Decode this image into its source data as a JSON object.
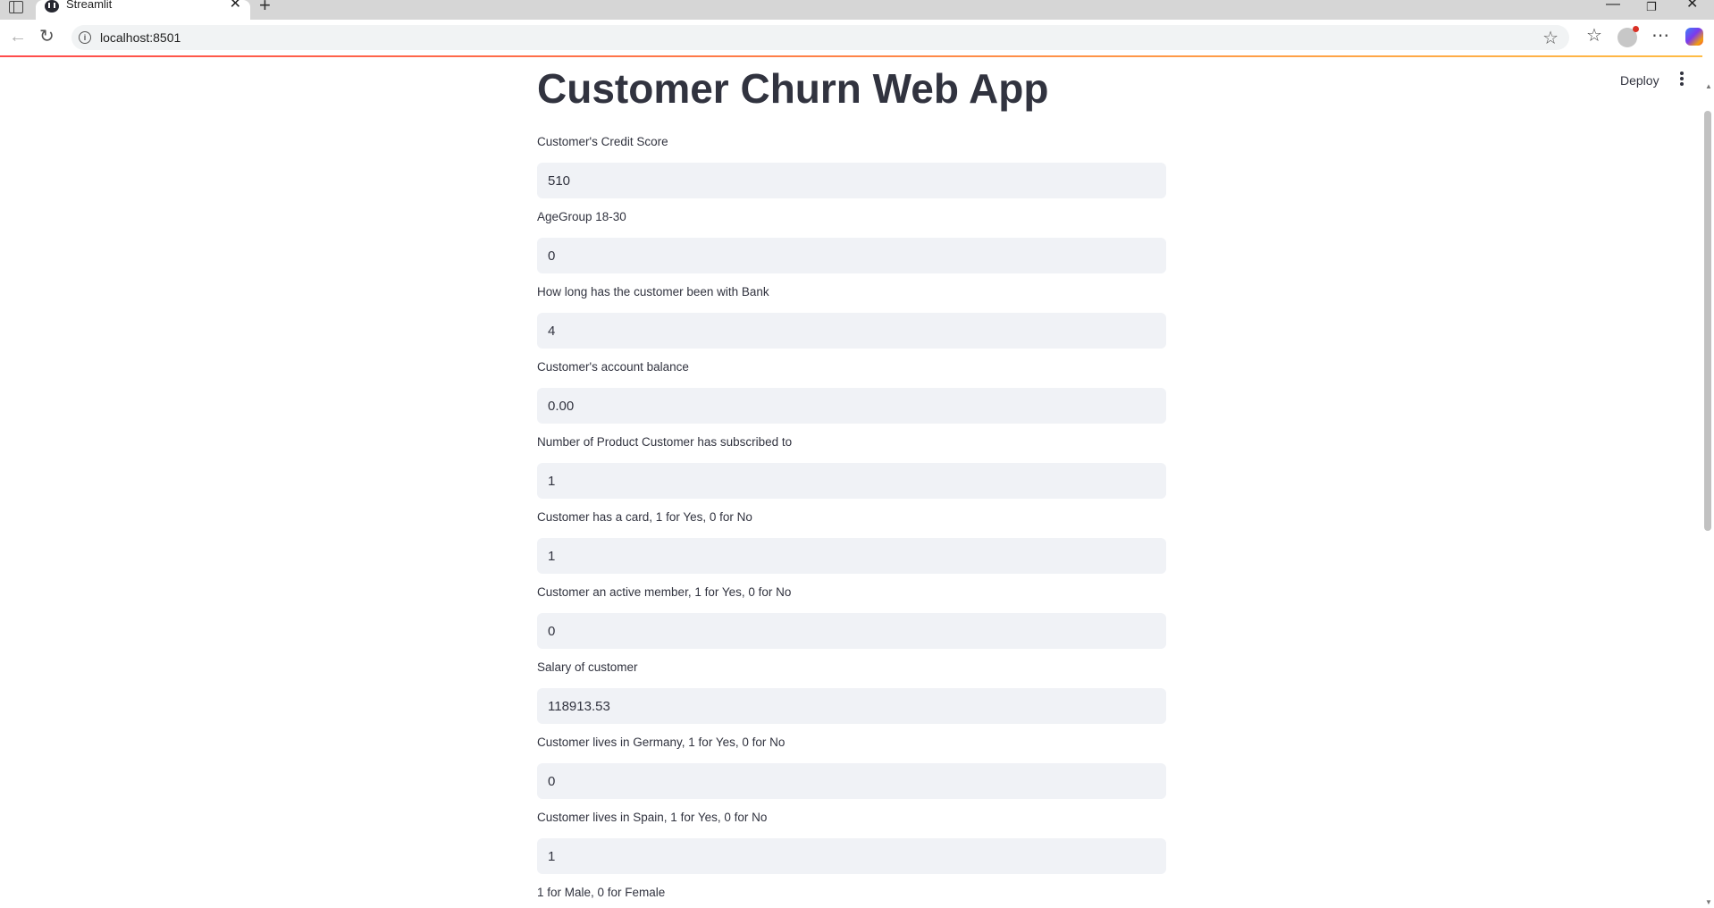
{
  "browser": {
    "tab_title": "Streamlit",
    "url": "localhost:8501",
    "icons": [
      "sidebar-toggle-icon",
      "close-icon",
      "plus-icon",
      "back-icon",
      "reload-icon",
      "info-icon",
      "star-icon",
      "favorites-icon",
      "profile-icon",
      "more-icon",
      "copilot-icon",
      "minimize-icon",
      "restore-icon",
      "close-window-icon"
    ]
  },
  "app": {
    "title": "Customer Churn Web App",
    "deploy_label": "Deploy",
    "accent_gradient": [
      "#ff4b4b",
      "#ffbd45"
    ],
    "input_bg": "#f0f2f6",
    "fields": [
      {
        "label": "Customer's Credit Score",
        "value": "510"
      },
      {
        "label": "AgeGroup 18-30",
        "value": "0"
      },
      {
        "label": "How long has the customer been with Bank",
        "value": "4"
      },
      {
        "label": "Customer's account balance",
        "value": "0.00"
      },
      {
        "label": "Number of Product Customer has subscribed to",
        "value": "1"
      },
      {
        "label": "Customer has a card, 1 for Yes, 0 for No",
        "value": "1"
      },
      {
        "label": "Customer an active member, 1 for Yes, 0 for No",
        "value": "0"
      },
      {
        "label": "Salary of customer",
        "value": "118913.53"
      },
      {
        "label": "Customer lives in Germany, 1 for Yes, 0 for No",
        "value": "0"
      },
      {
        "label": "Customer lives in Spain, 1 for Yes, 0 for No",
        "value": "1"
      },
      {
        "label": "1 for Male, 0 for Female",
        "value": ""
      }
    ]
  }
}
